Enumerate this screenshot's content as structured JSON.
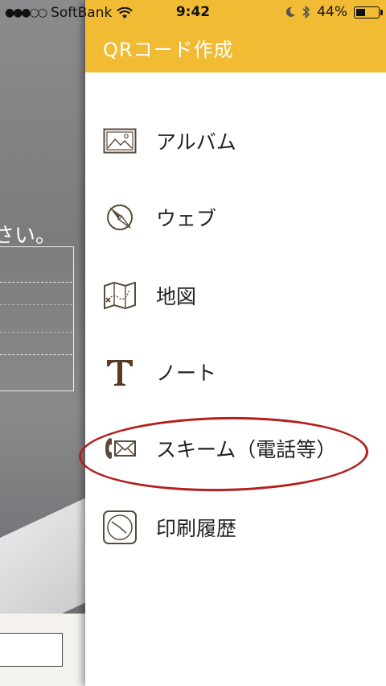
{
  "status_bar": {
    "signal": "●●●○○",
    "carrier": "SoftBank",
    "time": "9:42",
    "battery_percent": "44%",
    "battery_level": 0.44
  },
  "background": {
    "fragment_text": "さい。"
  },
  "drawer": {
    "title": "QRコード作成",
    "header_color": "#f2bb34",
    "items": [
      {
        "label": "アルバム",
        "icon": "photo-album-icon"
      },
      {
        "label": "ウェブ",
        "icon": "compass-icon"
      },
      {
        "label": "地図",
        "icon": "map-icon"
      },
      {
        "label": "ノート",
        "icon": "text-T-icon"
      },
      {
        "label": "スキーム（電話等）",
        "icon": "phone-mail-icon"
      },
      {
        "label": "印刷履歴",
        "icon": "clock-icon"
      }
    ]
  },
  "annotation": {
    "color": "#b41f1f"
  }
}
